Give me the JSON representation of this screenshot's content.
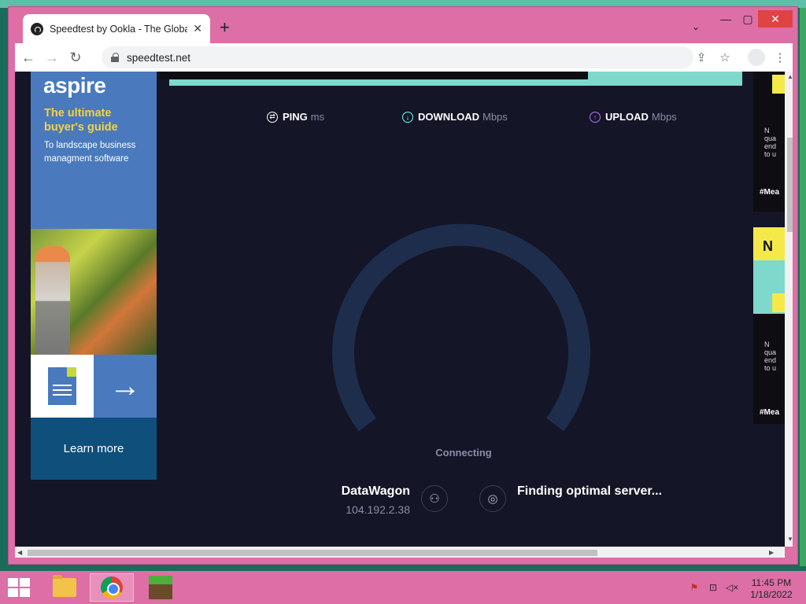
{
  "browser": {
    "tab_title": "Speedtest by Ookla - The Global",
    "tab_close": "✕",
    "new_tab": "+",
    "tab_dropdown": "⌄",
    "url": "speedtest.net",
    "window_controls": {
      "minimize": "—",
      "maximize": "▢",
      "close": "✕"
    }
  },
  "ad_left": {
    "logo": "aspire",
    "headline": "The ultimate buyer's guide",
    "subtext": "To landscape business managment software",
    "cta": "Learn more",
    "arrow": "→"
  },
  "speedtest": {
    "metrics": [
      {
        "label": "PING",
        "unit": "ms",
        "color": "#ffffff"
      },
      {
        "label": "DOWNLOAD",
        "unit": "Mbps",
        "color": "#6afff3"
      },
      {
        "label": "UPLOAD",
        "unit": "Mbps",
        "color": "#bf71ff"
      }
    ],
    "status": "Connecting",
    "isp_name": "DataWagon",
    "ip": "104.192.2.38",
    "server_status": "Finding optimal server...",
    "gauge_color": "#1e2d4c"
  },
  "ad_right": {
    "text_top": "N\nqua\nend\nto u",
    "tag_top": "#Mea",
    "banner_word": "N",
    "text_bottom": "N\nqua\nend\nto u",
    "tag_bottom": "#Mea"
  },
  "taskbar": {
    "time": "11:45 PM",
    "date": "1/18/2022"
  }
}
